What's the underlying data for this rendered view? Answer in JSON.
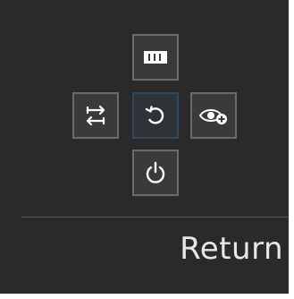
{
  "menu": {
    "buttons": [
      {
        "position": "top",
        "icon": "grid-icon",
        "selected": false
      },
      {
        "position": "left",
        "icon": "swap-arrows-icon",
        "selected": false
      },
      {
        "position": "center",
        "icon": "return-icon",
        "selected": true
      },
      {
        "position": "right",
        "icon": "eye-plus-icon",
        "selected": false
      },
      {
        "position": "bottom",
        "icon": "power-icon",
        "selected": false
      }
    ],
    "selected_label": "Return"
  },
  "colors": {
    "panel_background": "#2a2a2a",
    "button_border": "#6b6b6b",
    "selected_border": "#2a4a66",
    "icon_color": "#ffffff",
    "label_color": "#e8e8e8"
  }
}
